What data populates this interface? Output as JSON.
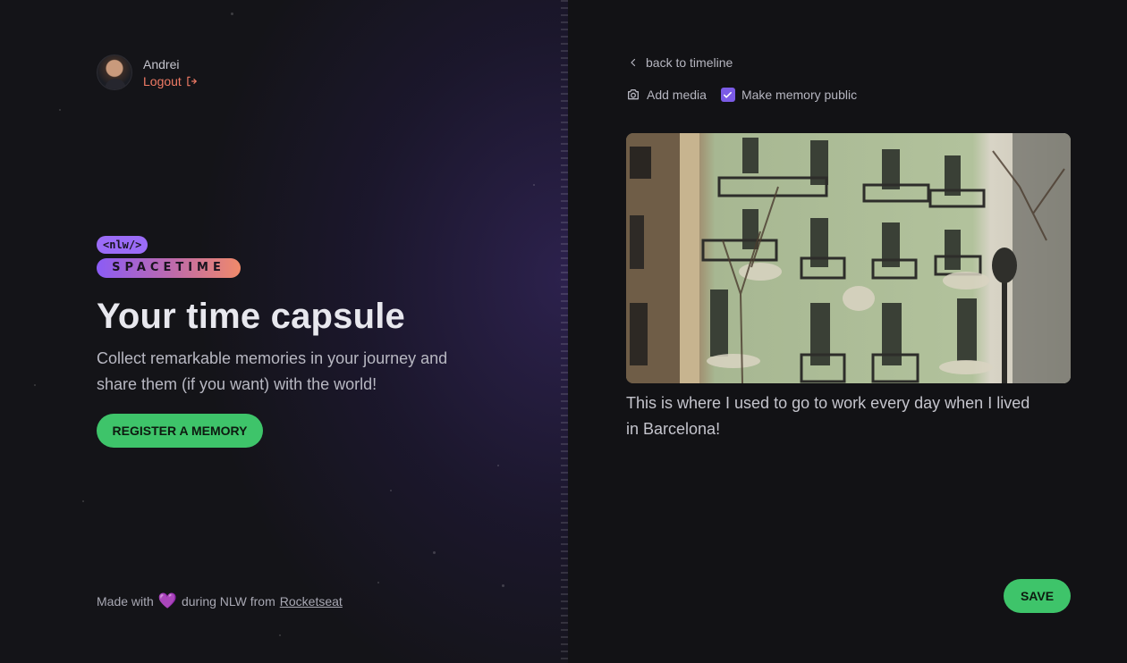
{
  "user": {
    "name": "Andrei",
    "logout_label": "Logout"
  },
  "brand": {
    "nlw_label": "<nlw/>",
    "spacetime_label": "SPACETIME"
  },
  "hero": {
    "title": "Your time capsule",
    "description": "Collect remarkable memories in your journey and share them (if you want) with the world!",
    "cta_label": "REGISTER A MEMORY"
  },
  "footer": {
    "prefix": "Made with",
    "middle": "during NLW from",
    "link_label": "Rocketseat"
  },
  "editor": {
    "back_label": "back to timeline",
    "add_media_label": "Add media",
    "public_label": "Make memory public",
    "public_checked": true,
    "caption": "This is where I used to go to work every day when I lived in Barcelona!",
    "save_label": "SAVE"
  },
  "colors": {
    "accent_green": "#3ec46a",
    "accent_purple": "#7b5be6",
    "logout_orange": "#f07b65"
  },
  "icons": {
    "logout": "logout-icon",
    "back": "chevron-left-icon",
    "camera": "camera-icon",
    "check": "check-icon",
    "heart": "purple-heart-icon"
  }
}
